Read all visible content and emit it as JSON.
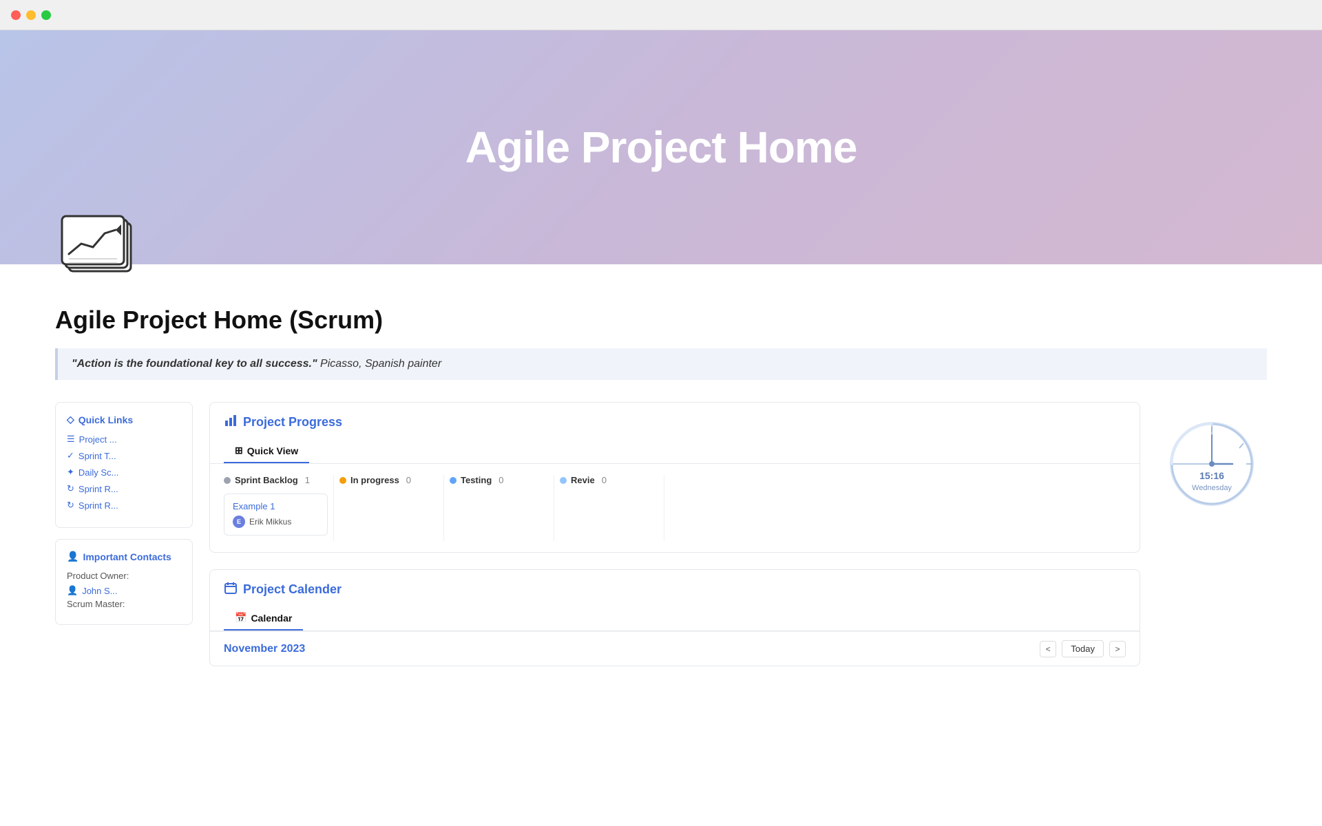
{
  "window": {
    "title": "Agile Project Home"
  },
  "hero": {
    "title": "Agile Project Home",
    "gradient_start": "#b8c4e8",
    "gradient_end": "#d4b8d0"
  },
  "page": {
    "title": "Agile Project Home (Scrum)",
    "quote": "\"Action is the foundational key to all success.\"",
    "quote_attribution": " Picasso, Spanish painter"
  },
  "sidebar": {
    "quick_links": {
      "title": "Quick Links",
      "items": [
        {
          "label": "Project ...",
          "icon": "list-icon"
        },
        {
          "label": "Sprint T...",
          "icon": "check-circle-icon"
        },
        {
          "label": "Daily Sc...",
          "icon": "star-icon"
        },
        {
          "label": "Sprint R...",
          "icon": "refresh-icon"
        },
        {
          "label": "Sprint R...",
          "icon": "refresh-icon"
        }
      ]
    },
    "contacts": {
      "title": "Important Contacts",
      "product_owner_label": "Product Owner:",
      "product_owner_name": "John S...",
      "scrum_master_label": "Scrum Master:"
    }
  },
  "project_progress": {
    "panel_title": "Project Progress",
    "tab_label": "Quick View",
    "columns": [
      {
        "name": "Sprint Backlog",
        "color": "#9ca3af",
        "count": 1
      },
      {
        "name": "In progress",
        "color": "#f59e0b",
        "count": 0
      },
      {
        "name": "Testing",
        "color": "#60a5fa",
        "count": 0
      },
      {
        "name": "Revie",
        "color": "#93c5fd",
        "count": 0
      }
    ],
    "cards": [
      {
        "column": 0,
        "title": "Example 1",
        "user": "Erik Mikkus",
        "user_initials": "E"
      }
    ]
  },
  "project_calendar": {
    "panel_title": "Project Calender",
    "tab_label": "Calendar",
    "month": "November 2023",
    "today_btn": "Today",
    "nav_prev": "<",
    "nav_next": ">"
  },
  "clock": {
    "time": "15:16",
    "day": "Wednesday"
  }
}
